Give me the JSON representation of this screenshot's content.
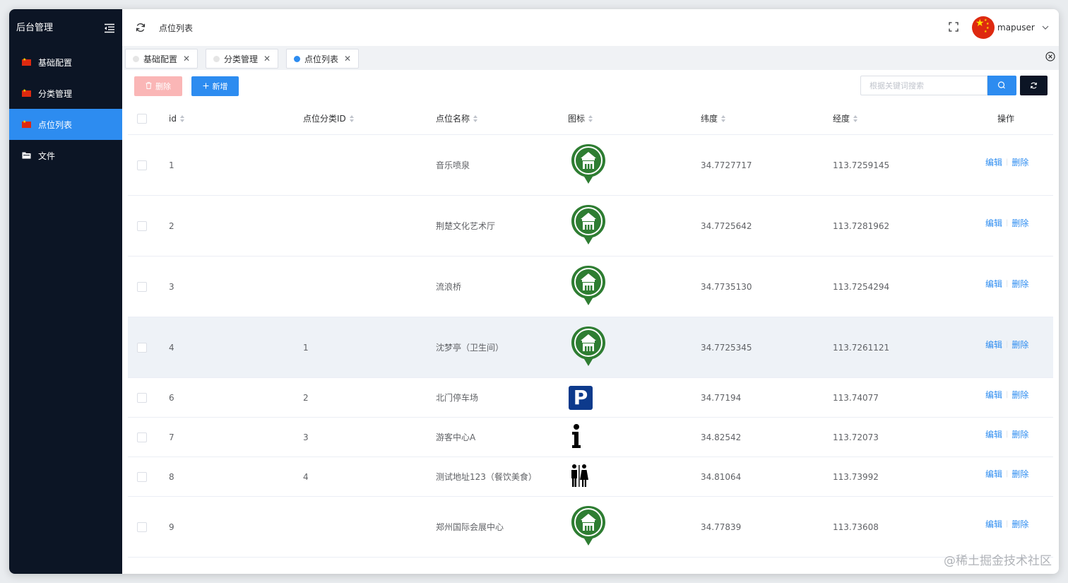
{
  "sidebar": {
    "brand": "后台管理",
    "items": [
      {
        "label": "基础配置",
        "icon": "china-flag-icon",
        "active": false
      },
      {
        "label": "分类管理",
        "icon": "china-flag-icon",
        "active": false
      },
      {
        "label": "点位列表",
        "icon": "china-flag-icon",
        "active": true
      },
      {
        "label": "文件",
        "icon": "folder-icon",
        "active": false
      }
    ]
  },
  "header": {
    "title": "点位列表",
    "username": "mapuser"
  },
  "tabs": [
    {
      "label": "基础配置",
      "active": false
    },
    {
      "label": "分类管理",
      "active": false
    },
    {
      "label": "点位列表",
      "active": true
    }
  ],
  "toolbar": {
    "delete_label": "删除",
    "add_label": "新增",
    "search_placeholder": "根据关键词搜索"
  },
  "table": {
    "columns": [
      "id",
      "点位分类ID",
      "点位名称",
      "图标",
      "纬度",
      "经度",
      "操作"
    ],
    "edit_label": "编辑",
    "delete_label": "删除",
    "rows": [
      {
        "id": "1",
        "category_id": "",
        "name": "音乐喷泉",
        "icon": "green-pavilion-marker-icon",
        "lat": "34.7727717",
        "lng": "113.7259145"
      },
      {
        "id": "2",
        "category_id": "",
        "name": "荆楚文化艺术厅",
        "icon": "green-pavilion-marker-icon",
        "lat": "34.7725642",
        "lng": "113.7281962"
      },
      {
        "id": "3",
        "category_id": "",
        "name": "流浪桥",
        "icon": "green-pavilion-marker-icon",
        "lat": "34.7735130",
        "lng": "113.7254294"
      },
      {
        "id": "4",
        "category_id": "1",
        "name": "沈梦亭（卫生间）",
        "icon": "green-pavilion-marker-icon",
        "lat": "34.7725345",
        "lng": "113.7261121"
      },
      {
        "id": "6",
        "category_id": "2",
        "name": "北门停车场",
        "icon": "parking-icon",
        "lat": "34.77194",
        "lng": "113.74077"
      },
      {
        "id": "7",
        "category_id": "3",
        "name": "游客中心A",
        "icon": "info-icon",
        "lat": "34.82542",
        "lng": "113.72073"
      },
      {
        "id": "8",
        "category_id": "4",
        "name": "测试地址123（餐饮美食）",
        "icon": "restroom-icon",
        "lat": "34.81064",
        "lng": "113.73992"
      },
      {
        "id": "9",
        "category_id": "",
        "name": "郑州国际会展中心",
        "icon": "green-pavilion-marker-icon",
        "lat": "34.77839",
        "lng": "113.73608"
      }
    ]
  },
  "watermark": "@稀土掘金技术社区",
  "colors": {
    "sidebar_bg": "#0c1525",
    "accent": "#2d8cf0",
    "marker_green": "#2e7d32",
    "parking_blue": "#0d3a8c"
  }
}
